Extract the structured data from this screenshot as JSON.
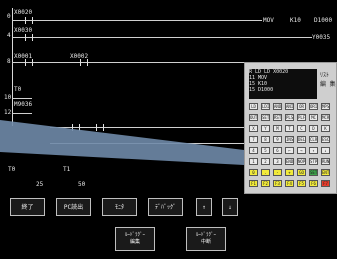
{
  "ladder": {
    "rungs": [
      {
        "contact": "X0020",
        "row_label": "0"
      },
      {
        "contact": "X0030",
        "row_label": "4"
      },
      {
        "contact": "X0001",
        "contact2": "X0002",
        "row_label": "8"
      },
      {
        "contact": "T0",
        "row_label": "10"
      },
      {
        "contact": "M9036",
        "row_label": "12"
      }
    ],
    "right_instr": {
      "op": "MOV",
      "src": "K10",
      "dst": "D1000"
    },
    "coil_y": "Y0035"
  },
  "timers": [
    {
      "name": "T0",
      "value": "25"
    },
    {
      "name": "T1",
      "value": "50"
    }
  ],
  "function_buttons": [
    "終了",
    "PC読出",
    "ﾓﾆﾀ",
    "ﾃﾞﾊﾞｯｸﾞ"
  ],
  "arrow_buttons": [
    "↑",
    "↓"
  ],
  "bottom_buttons": [
    {
      "line1": "ﾙｰﾄﾞﾗｸﾞｰ",
      "line2": "編集"
    },
    {
      "line1": "ﾙｰﾄﾞﾗｸﾞｰ",
      "line2": "中断"
    }
  ],
  "popup": {
    "display_lines": [
      "R  LD  LD     X0020",
      "    11 MOV",
      "    15  K10",
      "    15  D1000"
    ],
    "side_label_1": "ﾘｽﾄ",
    "side_label_2": "編 集",
    "keys": [
      [
        "LD",
        "LDI",
        "AND",
        "ANI",
        "OR",
        "ORI",
        "MPS"
      ],
      [
        "OUT",
        "SET",
        "RST",
        "PLS",
        "PLF",
        "MC",
        "MCR"
      ],
      [
        "X",
        "Y",
        "M",
        "T",
        "C",
        "D",
        "K"
      ],
      [
        "7",
        "8",
        "9",
        "INS",
        "DEL",
        "CLR",
        "ESC"
      ],
      [
        "4",
        "5",
        "6",
        "←",
        "→",
        "↑",
        "↓"
      ],
      [
        "1",
        "2",
        "3",
        "END",
        "NOP",
        "STP",
        "RUN"
      ],
      [
        "0",
        ".",
        "-",
        "+",
        "GO",
        "SET",
        "ENT"
      ],
      [
        "F1",
        "F2",
        "F3",
        "F4",
        "F5",
        "F6",
        "F7"
      ]
    ],
    "colors": {
      "gray": "#e9e9e9",
      "yellow": "#f1ea3a",
      "red": "#e43b2a",
      "green": "#3fa24b"
    }
  }
}
